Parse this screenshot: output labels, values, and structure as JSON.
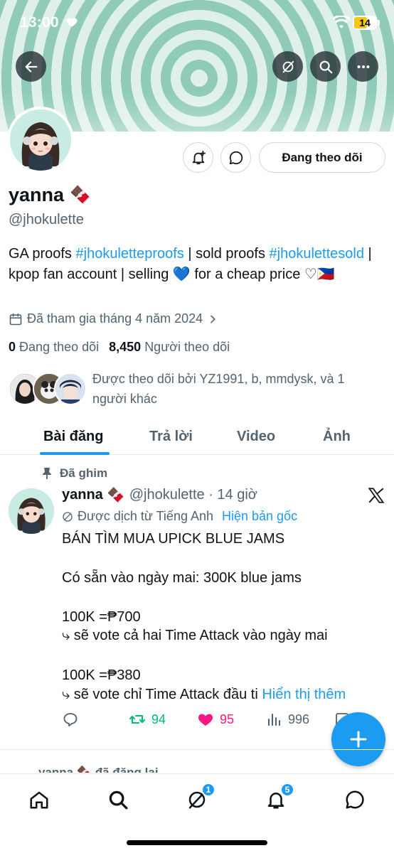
{
  "status_bar": {
    "time": "13:00",
    "battery": "14"
  },
  "profile": {
    "name": "yanna",
    "name_emoji": "🍫",
    "handle": "@jhokulette",
    "follow_button": "Đang theo dõi",
    "bio": {
      "part1": "GA proofs ",
      "tag1": "#jhokuletteproofs",
      "part2": " | sold proofs ",
      "tag2": "#jhokulettesold",
      "part3": " | kpop fan account | selling 💙 for a cheap price ♡🇵🇭"
    },
    "joined": "Đã tham gia tháng 4 năm 2024",
    "following_count": "0",
    "following_label": "Đang theo dõi",
    "followers_count": "8,450",
    "followers_label": "Người theo dõi",
    "followed_by": "Được theo dõi bởi YZ1991, b, mmdysk, và 1 người khác"
  },
  "tabs": [
    "Bài đăng",
    "Trả lời",
    "Video",
    "Ảnh"
  ],
  "pinned_post": {
    "pinned_label": "Đã ghim",
    "author": "yanna",
    "author_emoji": "🍫",
    "handle_time": "@jhokulette · 14 giờ",
    "translated_label": "Được dịch từ Tiếng Anh",
    "show_original": "Hiện bản gốc",
    "lines": [
      "BÁN TÌM MUA UPICK BLUE JAMS",
      "Có sẵn vào ngày mai: 300K blue jams",
      "100K =₱700",
      "⤷ sẽ vote cả hai Time Attack vào ngày mai",
      "100K =₱380",
      "⤷ sẽ vote chỉ Time Attack đầu ti"
    ],
    "show_more": "Hiển thị thêm",
    "retweets": "94",
    "likes": "95",
    "views": "996"
  },
  "next_post_peek": "yanna 🍫 đã đăng lại",
  "tab_bar": {
    "grok_badge": "1",
    "notifications_badge": "5"
  },
  "colors": {
    "accent": "#1d9bf0",
    "like": "#f91880",
    "retweet": "#00ba7c"
  }
}
